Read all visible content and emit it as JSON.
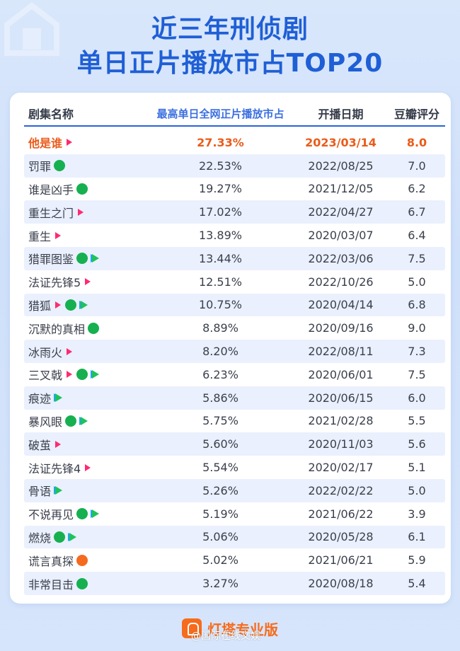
{
  "title": {
    "line1": "近三年刑侦剧",
    "line2": "单日正片播放市占TOP20"
  },
  "colors": {
    "title": "#1f5fd6",
    "highlight": "#ea5b1a",
    "accent_header": "#3c70e0",
    "mango": "#ff2b6e",
    "iqiyi": "#16b050",
    "tencent": "#20c25a",
    "youku": "#f56a1f",
    "brand": "#f76b1c"
  },
  "table": {
    "headers": {
      "name": "剧集名称",
      "share": "最高单日全网正片播放市占",
      "date": "开播日期",
      "score": "豆瓣评分"
    },
    "rows": [
      {
        "name": "他是谁",
        "platforms": [
          "mango-icon"
        ],
        "share": "27.33%",
        "date": "2023/03/14",
        "score": "8.0"
      },
      {
        "name": "罚罪",
        "platforms": [
          "iqiyi-icon"
        ],
        "share": "22.53%",
        "date": "2022/08/25",
        "score": "7.0"
      },
      {
        "name": "谁是凶手",
        "platforms": [
          "iqiyi-icon"
        ],
        "share": "19.27%",
        "date": "2021/12/05",
        "score": "6.2"
      },
      {
        "name": "重生之门",
        "platforms": [
          "mango-icon"
        ],
        "share": "17.02%",
        "date": "2022/04/27",
        "score": "6.7"
      },
      {
        "name": "重生",
        "platforms": [
          "mango-icon"
        ],
        "share": "13.89%",
        "date": "2020/03/07",
        "score": "6.4"
      },
      {
        "name": "猎罪图鉴",
        "platforms": [
          "iqiyi-icon",
          "tencent-icon"
        ],
        "share": "13.44%",
        "date": "2022/03/06",
        "score": "7.5"
      },
      {
        "name": "法证先锋5",
        "platforms": [
          "mango-icon"
        ],
        "share": "12.51%",
        "date": "2022/10/26",
        "score": "5.0"
      },
      {
        "name": "猎狐",
        "platforms": [
          "mango-icon",
          "iqiyi-icon",
          "tencent-icon"
        ],
        "share": "10.75%",
        "date": "2020/04/14",
        "score": "6.8"
      },
      {
        "name": "沉默的真相",
        "platforms": [
          "iqiyi-icon"
        ],
        "share": "8.89%",
        "date": "2020/09/16",
        "score": "9.0"
      },
      {
        "name": "冰雨火",
        "platforms": [
          "mango-icon"
        ],
        "share": "8.20%",
        "date": "2022/08/11",
        "score": "7.3"
      },
      {
        "name": "三叉戟",
        "platforms": [
          "mango-icon",
          "iqiyi-icon",
          "tencent-icon"
        ],
        "share": "6.23%",
        "date": "2020/06/01",
        "score": "7.5"
      },
      {
        "name": "痕迹",
        "platforms": [
          "tencent-icon"
        ],
        "share": "5.86%",
        "date": "2020/06/15",
        "score": "6.0"
      },
      {
        "name": "暴风眼",
        "platforms": [
          "iqiyi-icon",
          "tencent-icon"
        ],
        "share": "5.75%",
        "date": "2021/02/28",
        "score": "5.5"
      },
      {
        "name": "破茧",
        "platforms": [
          "mango-icon"
        ],
        "share": "5.60%",
        "date": "2020/11/03",
        "score": "5.6"
      },
      {
        "name": "法证先锋4",
        "platforms": [
          "mango-icon"
        ],
        "share": "5.54%",
        "date": "2020/02/17",
        "score": "5.1"
      },
      {
        "name": "骨语",
        "platforms": [
          "tencent-icon"
        ],
        "share": "5.26%",
        "date": "2022/02/22",
        "score": "5.0"
      },
      {
        "name": "不说再见",
        "platforms": [
          "iqiyi-icon",
          "tencent-icon"
        ],
        "share": "5.19%",
        "date": "2021/06/22",
        "score": "3.9"
      },
      {
        "name": "燃烧",
        "platforms": [
          "iqiyi-icon",
          "tencent-icon"
        ],
        "share": "5.06%",
        "date": "2020/05/28",
        "score": "6.1"
      },
      {
        "name": "谎言真探",
        "platforms": [
          "youku-icon"
        ],
        "share": "5.02%",
        "date": "2021/06/21",
        "score": "5.9"
      },
      {
        "name": "非常目击",
        "platforms": [
          "iqiyi-icon"
        ],
        "share": "3.27%",
        "date": "2020/08/18",
        "score": "5.4"
      }
    ]
  },
  "footer": {
    "brand": "灯塔专业版",
    "watermark": "@国际在线文娱"
  }
}
